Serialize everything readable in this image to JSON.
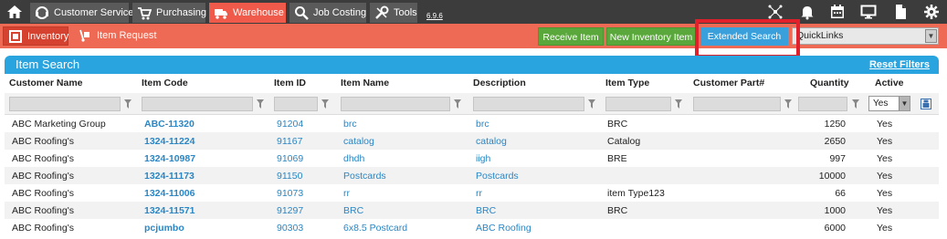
{
  "topnav": {
    "tabs": [
      {
        "label": "Customer Service",
        "icon": "headset-icon"
      },
      {
        "label": "Purchasing",
        "icon": "cart-icon"
      },
      {
        "label": "Warehouse",
        "icon": "truck-icon"
      },
      {
        "label": "Job Costing",
        "icon": "search-icon"
      },
      {
        "label": "Tools",
        "icon": "wrench-icon"
      }
    ],
    "version": "6.9.6",
    "right_icons": [
      "network-icon",
      "bell-icon",
      "calendar-icon",
      "monitor-icon",
      "document-icon",
      "gear-icon"
    ]
  },
  "subbar": {
    "tabs": [
      {
        "label": "Inventory",
        "icon": "inventory-icon"
      },
      {
        "label": "Item Request",
        "icon": "hand-truck-icon"
      }
    ],
    "buttons": {
      "receive": "Receive Item",
      "new_inventory": "New Inventory Item",
      "extended_search": "Extended Search"
    },
    "quicklinks": "QuickLinks"
  },
  "colors": {
    "topnav_bg": "#3c3c3c",
    "accent": "#ee6a55",
    "panel_header": "#29a4df",
    "green_button": "#5aa83b",
    "link": "#2a86c4",
    "highlight_box": "#e0202a"
  },
  "panel": {
    "title": "Item Search",
    "reset_filters": "Reset Filters"
  },
  "table": {
    "columns": [
      "Customer Name",
      "Item Code",
      "Item ID",
      "Item Name",
      "Description",
      "Item Type",
      "Customer Part#",
      "Quantity",
      "Active"
    ],
    "active_filter": "Yes",
    "rows": [
      {
        "customer": "ABC Marketing Group",
        "code": "ABC-11320",
        "id": "91204",
        "name": "brc",
        "description": "brc",
        "type": "BRC",
        "part": "",
        "quantity": "1250",
        "active": "Yes"
      },
      {
        "customer": "ABC Roofing's",
        "code": "1324-11224",
        "id": "91167",
        "name": "catalog",
        "description": "catalog",
        "type": "Catalog",
        "part": "",
        "quantity": "2650",
        "active": "Yes"
      },
      {
        "customer": "ABC Roofing's",
        "code": "1324-10987",
        "id": "91069",
        "name": "dhdh",
        "description": "iigh",
        "type": "BRE",
        "part": "",
        "quantity": "997",
        "active": "Yes"
      },
      {
        "customer": "ABC Roofing's",
        "code": "1324-11173",
        "id": "91150",
        "name": "Postcards",
        "description": "Postcards",
        "type": "",
        "part": "",
        "quantity": "10000",
        "active": "Yes"
      },
      {
        "customer": "ABC Roofing's",
        "code": "1324-11006",
        "id": "91073",
        "name": "rr",
        "description": "rr",
        "type": "item Type123",
        "part": "",
        "quantity": "66",
        "active": "Yes"
      },
      {
        "customer": "ABC Roofing's",
        "code": "1324-11571",
        "id": "91297",
        "name": "BRC",
        "description": "BRC",
        "type": "BRC",
        "part": "",
        "quantity": "1000",
        "active": "Yes"
      },
      {
        "customer": "ABC Roofing's",
        "code": "pcjumbo",
        "id": "90303",
        "name": "6x8.5 Postcard",
        "description": "ABC Roofing",
        "type": "",
        "part": "",
        "quantity": "6000",
        "active": "Yes"
      }
    ]
  }
}
